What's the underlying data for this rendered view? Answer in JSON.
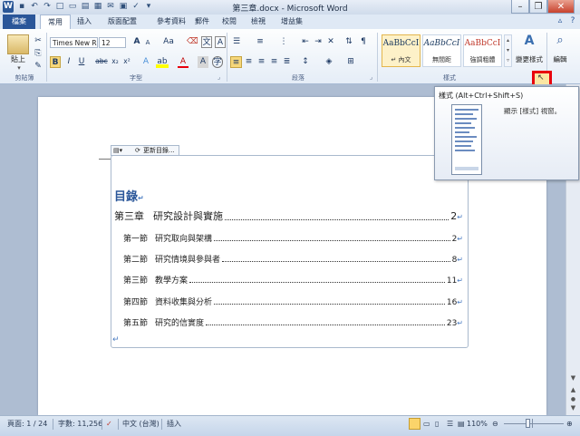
{
  "window": {
    "title": "第三章.docx - Microsoft Word",
    "app_icon": "W"
  },
  "tabs": [
    "檔案",
    "常用",
    "插入",
    "版面配置",
    "參考資料",
    "郵件",
    "校閱",
    "檢視",
    "增益集"
  ],
  "ribbon": {
    "paste_label": "貼上",
    "font_name": "Times New R",
    "font_size": "12",
    "bold": "B",
    "italic": "I",
    "underline": "U",
    "strike": "abc",
    "sub": "x₂",
    "sup": "x²",
    "grow_font": "A",
    "shrink_font": "A",
    "styles": [
      {
        "sample": "AaBbCcI",
        "name": "↵ 內文"
      },
      {
        "sample": "AaBbCcI",
        "name": "無間距"
      },
      {
        "sample": "AaBbCcI",
        "name": "強調粗體"
      }
    ],
    "change_styles_label": "變更樣式",
    "edit_label": "編輯",
    "groups": {
      "clipboard": "剪貼簿",
      "font": "字型",
      "paragraph": "段落",
      "styles": "樣式"
    }
  },
  "tooltip": {
    "title": "樣式 (Alt+Ctrl+Shift+S)",
    "desc": "顯示 [樣式] 視窗。"
  },
  "toc": {
    "update_button": "更新目錄...",
    "heading": "目錄",
    "chapter": {
      "label": "第三章",
      "title": "研究設計與實施",
      "page": "2"
    },
    "sections": [
      {
        "label": "第一節",
        "title": "研究取向與架構",
        "page": "2"
      },
      {
        "label": "第二節",
        "title": "研究情境與參與者",
        "page": "8"
      },
      {
        "label": "第三節",
        "title": "教學方案",
        "page": "11"
      },
      {
        "label": "第四節",
        "title": "資料收集與分析",
        "page": "16"
      },
      {
        "label": "第五節",
        "title": "研究的信實度",
        "page": "23"
      }
    ]
  },
  "status": {
    "page": "頁面: 1 / 24",
    "words": "字數: 11,256",
    "language": "中文 (台灣)",
    "mode": "插入",
    "zoom": "110%"
  },
  "colors": {
    "accent": "#2a5699",
    "highlight": "#e8000d",
    "heading": "#2b579a"
  }
}
